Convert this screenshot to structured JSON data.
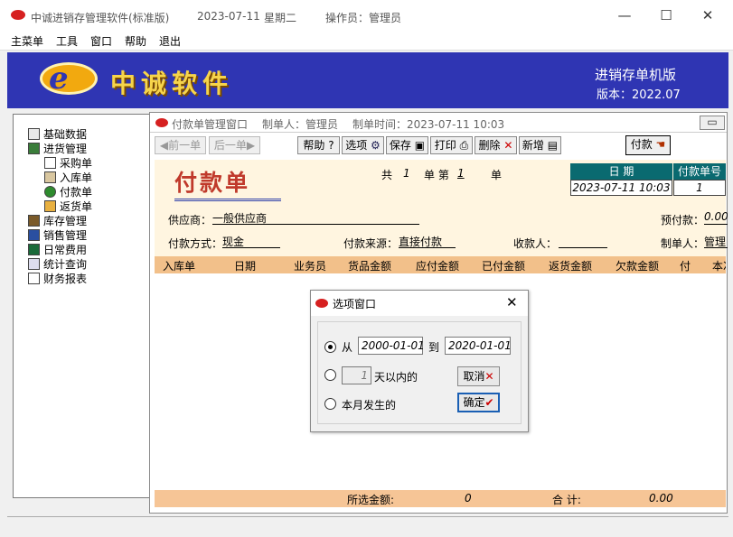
{
  "titlebar": {
    "app_title": "中诚进销存管理软件(标准版)",
    "date": "2023-07-11",
    "weekday": "星期二",
    "operator": "操作员：管理员",
    "min": "—",
    "max": "☐",
    "close": "✕"
  },
  "menu": [
    "主菜单",
    "工具",
    "窗口",
    "帮助",
    "退出"
  ],
  "banner": {
    "brand": "中诚软件",
    "edition": "进销存单机版",
    "version": "版本：2022.07",
    "logo_letter": "e"
  },
  "sidebar": {
    "items": [
      "基础数据",
      "进货管理",
      "采购单",
      "入库单",
      "付款单",
      "返货单",
      "库存管理",
      "销售管理",
      "日常费用",
      "统计查询",
      "财务报表"
    ]
  },
  "child": {
    "caption": "付款单管理窗口",
    "maker": "制单人：管理员",
    "make_time": "制单时间：2023-07-11 10:03",
    "toolbar": {
      "prev": "◀前一单",
      "next": "后一单▶",
      "help": "帮助",
      "select": "选项",
      "save": "保存",
      "print": "打印",
      "delete": "删除",
      "new": "新增",
      "pay": "付款"
    },
    "doc_title": "付款单",
    "total_label": "共",
    "total_count": "1",
    "unit_label": "单 第",
    "current_index": "1",
    "unit_label2": "单",
    "date_header": "日 期",
    "doc_no_header": "付款单号",
    "date_value": "2023-07-11 10:03",
    "doc_no_value": "1",
    "supplier_label": "供应商：",
    "supplier_value": "一般供应商",
    "prepay_label": "预付款：",
    "prepay_value": "0.00",
    "paymethod_label": "付款方式：",
    "paymethod_value": "现金",
    "source_label": "付款来源：",
    "source_value": "直接付款",
    "payee_label": "收款人：",
    "payee_value": "",
    "creator_label": "制单人：",
    "creator_value": "管理",
    "columns": [
      "入库单",
      "日期",
      "业务员",
      "货品金额",
      "应付金额",
      "已付金额",
      "返货金额",
      "欠款金额",
      "付",
      "本次"
    ],
    "footer": {
      "selected_label": "所选金额:",
      "selected_value": "0",
      "total_label": "合 计:",
      "total_value": "0.00"
    }
  },
  "dialog": {
    "title": "选项窗口",
    "close": "✕",
    "from_label": "从",
    "from_value": "2000-01-01",
    "to_label": "到",
    "to_value": "2020-01-01",
    "days_value": "1",
    "days_label": "天以内的",
    "month_label": "本月发生的",
    "cancel": "取消",
    "ok": "确定"
  },
  "colors": {
    "banner": "#2f35b3",
    "brand_text": "#f6d44b",
    "doc_title": "#c0392b",
    "grid_header": "#f2c08a",
    "form_bg": "#fff5e0",
    "dark_teal": "#0a6a70"
  }
}
